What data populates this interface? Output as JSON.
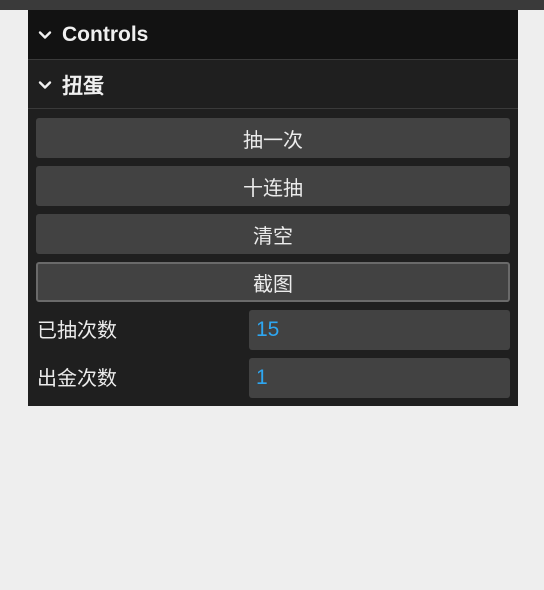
{
  "controls": {
    "title": "Controls",
    "expanded": true
  },
  "folder": {
    "title": "扭蛋",
    "expanded": true
  },
  "buttons": {
    "draw_once": "抽一次",
    "draw_ten": "十连抽",
    "clear": "清空",
    "screenshot": "截图"
  },
  "fields": {
    "draw_count": {
      "label": "已抽次数",
      "value": "15"
    },
    "gold_count": {
      "label": "出金次数",
      "value": "1"
    }
  },
  "colors": {
    "panel_bg": "#1f1f1f",
    "header_bg": "#121212",
    "button_bg": "#424242",
    "number_value": "#2ea7f2",
    "page_bg": "#eeeeee"
  }
}
